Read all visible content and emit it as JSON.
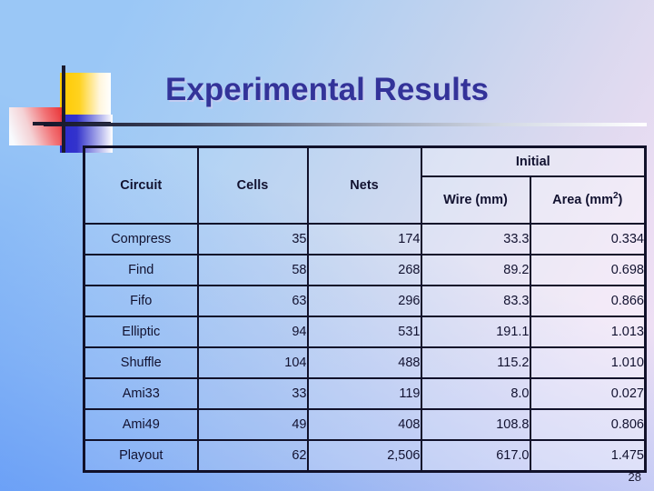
{
  "slide": {
    "title": "Experimental Results",
    "page_number": "28",
    "accent_title_color": "#333399",
    "background_colors": {
      "top_left": "#9AC7F6",
      "top_right": "#EFE0F4",
      "bottom_left": "#5C95F7",
      "bottom_right": "#A8CEF0"
    }
  },
  "logo": {
    "yellow_square": "yellow-gradient-square",
    "blue_square": "blue-gradient-square",
    "red_square": "red-gradient-square",
    "vertical_rule": "vertical-rule",
    "horizontal_rule": "horizontal-rule"
  },
  "table": {
    "group_header": "Initial",
    "columns": [
      {
        "key": "circuit",
        "label": "Circuit"
      },
      {
        "key": "cells",
        "label": "Cells"
      },
      {
        "key": "nets",
        "label": "Nets"
      },
      {
        "key": "wire",
        "label": "Wire (mm)"
      },
      {
        "key": "area",
        "label": "Area (mm",
        "sup": "2",
        "label_tail": ")"
      }
    ],
    "rows": [
      {
        "circuit": "Compress",
        "cells": "35",
        "nets": "174",
        "wire": "33.3",
        "area": "0.334"
      },
      {
        "circuit": "Find",
        "cells": "58",
        "nets": "268",
        "wire": "89.2",
        "area": "0.698"
      },
      {
        "circuit": "Fifo",
        "cells": "63",
        "nets": "296",
        "wire": "83.3",
        "area": "0.866"
      },
      {
        "circuit": "Elliptic",
        "cells": "94",
        "nets": "531",
        "wire": "191.1",
        "area": "1.013"
      },
      {
        "circuit": "Shuffle",
        "cells": "104",
        "nets": "488",
        "wire": "115.2",
        "area": "1.010"
      },
      {
        "circuit": "Ami33",
        "cells": "33",
        "nets": "119",
        "wire": "8.0",
        "area": "0.027"
      },
      {
        "circuit": "Ami49",
        "cells": "49",
        "nets": "408",
        "wire": "108.8",
        "area": "0.806"
      },
      {
        "circuit": "Playout",
        "cells": "62",
        "nets": "2,506",
        "wire": "617.0",
        "area": "1.475"
      }
    ]
  }
}
